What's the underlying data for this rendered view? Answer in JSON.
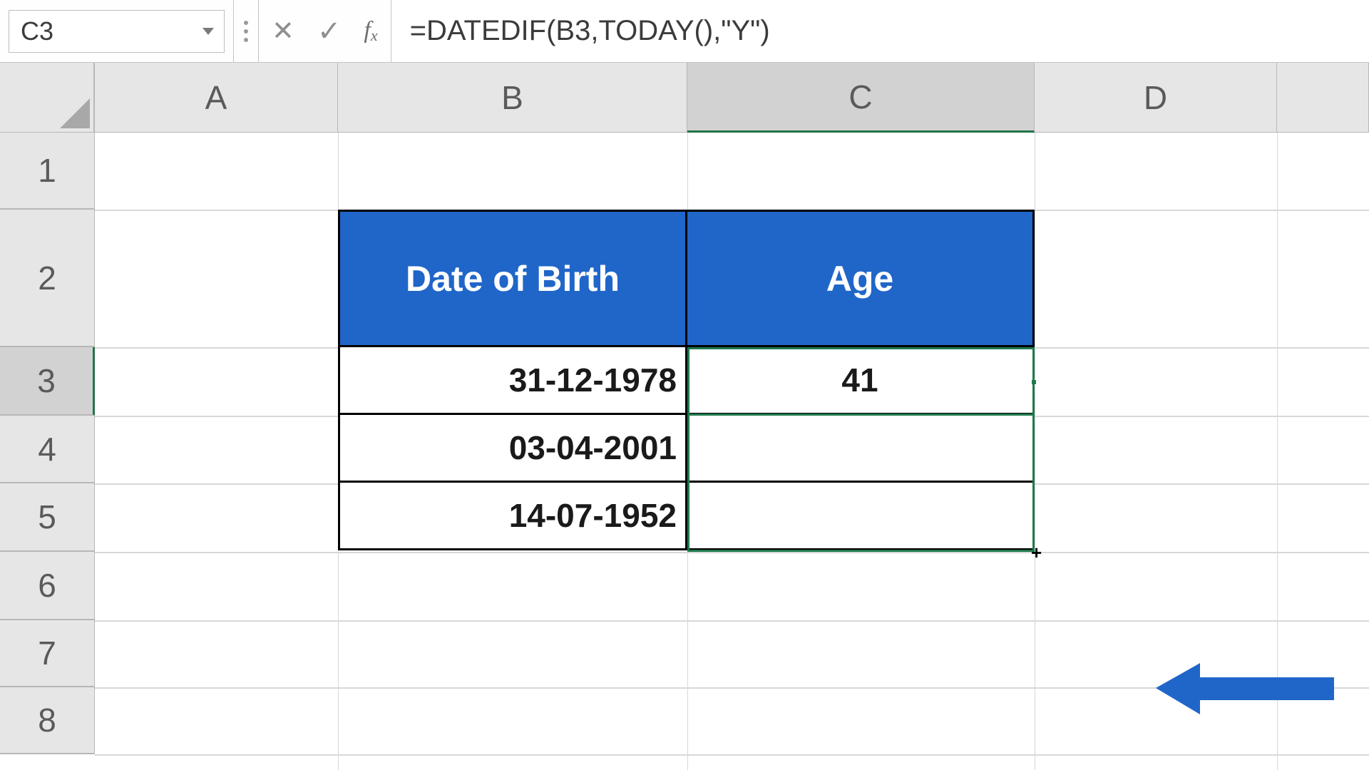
{
  "namebox": {
    "value": "C3"
  },
  "formula": {
    "value": "=DATEDIF(B3,TODAY(),\"Y\")"
  },
  "columns": {
    "A": "A",
    "B": "B",
    "C": "C",
    "D": "D"
  },
  "rows": {
    "1": "1",
    "2": "2",
    "3": "3",
    "4": "4",
    "5": "5",
    "6": "6",
    "7": "7",
    "8": "8"
  },
  "table": {
    "header_b": "Date of Birth",
    "header_c": "Age",
    "r3": {
      "b": "31-12-1978",
      "c": "41"
    },
    "r4": {
      "b": "03-04-2001",
      "c": ""
    },
    "r5": {
      "b": "14-07-1952",
      "c": ""
    }
  },
  "colors": {
    "header_bg": "#2066c9",
    "selection": "#1f7a4d",
    "arrow": "#2066c9"
  },
  "selected_cell": "C3",
  "fill_drag_range": "C3:C5"
}
